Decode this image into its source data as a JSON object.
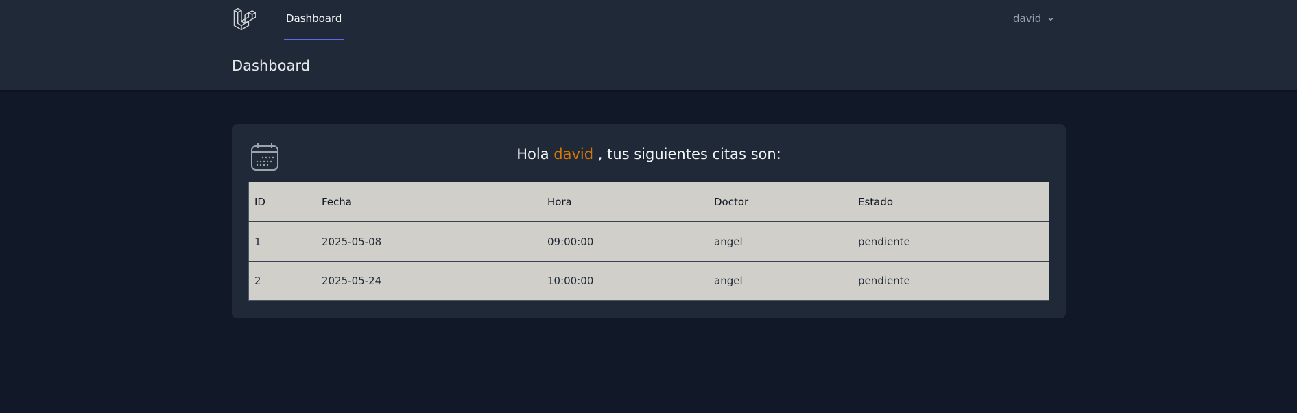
{
  "nav": {
    "logo_icon": "laravel-logo-icon",
    "dashboard_link": "Dashboard",
    "user_name": "david",
    "dropdown_icon": "chevron-down-icon"
  },
  "header": {
    "title": "Dashboard"
  },
  "card": {
    "icon": "calendar-icon",
    "greeting_prefix": "Hola",
    "greeting_name": "david",
    "greeting_suffix": ", tus siguientes citas son:",
    "table": {
      "columns": [
        "ID",
        "Fecha",
        "Hora",
        "Doctor",
        "Estado"
      ],
      "rows": [
        [
          "1",
          "2025-05-08",
          "09:00:00",
          "angel",
          "pendiente"
        ],
        [
          "2",
          "2025-05-24",
          "10:00:00",
          "angel",
          "pendiente"
        ]
      ]
    }
  },
  "colors": {
    "background": "#111827",
    "panel": "#1f2937",
    "accent": "#6366f1",
    "name_highlight": "#d97706",
    "table_bg": "#d1cfc9"
  }
}
